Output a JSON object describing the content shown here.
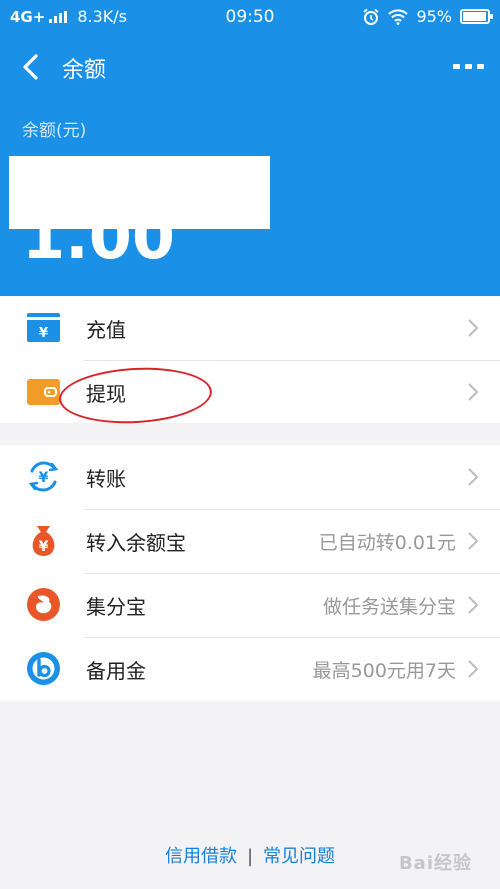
{
  "status_bar": {
    "network": "4G+",
    "speed": "8.3K/s",
    "time": "09:50",
    "battery": "95%",
    "battery_level": 0.95
  },
  "header": {
    "title": "余额",
    "balance_label": "余额(元)",
    "balance_value": "1.00"
  },
  "group1": [
    {
      "label": "充值",
      "icon": "recharge-card-icon"
    },
    {
      "label": "提现",
      "icon": "wallet-icon"
    }
  ],
  "group2": [
    {
      "label": "转账",
      "value": "",
      "icon": "transfer-icon"
    },
    {
      "label": "转入余额宝",
      "value": "已自动转0.01元",
      "icon": "money-bag-icon"
    },
    {
      "label": "集分宝",
      "value": "做任务送集分宝",
      "icon": "jifenbao-icon"
    },
    {
      "label": "备用金",
      "value": "最高500元用7天",
      "icon": "beiyongjin-icon"
    }
  ],
  "footer": {
    "link1": "信用借款",
    "separator": "|",
    "link2": "常见问题"
  },
  "watermark": "Bai经验",
  "colors": {
    "primary": "#1a90e6",
    "orange": "#f39c2a",
    "red": "#e8562a",
    "annotation": "#d8242a"
  }
}
